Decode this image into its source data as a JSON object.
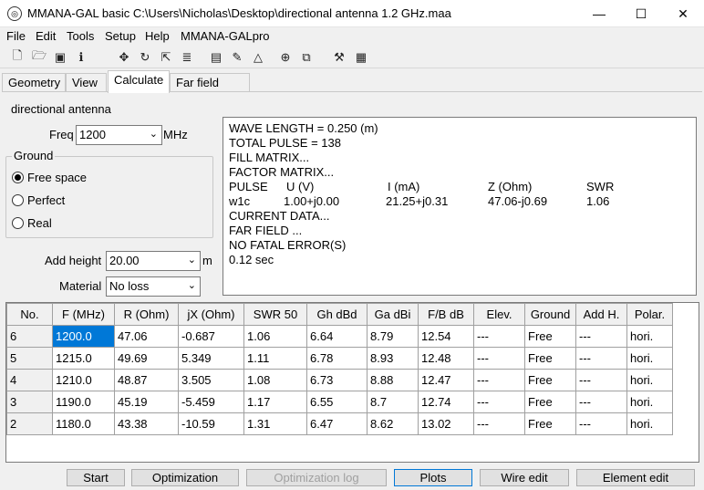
{
  "window": {
    "title": "MMANA-GAL basic C:\\Users\\Nicholas\\Desktop\\directional antenna 1.2 GHz.maa",
    "minimize": "—",
    "maximize": "☐",
    "close": "✕"
  },
  "menu": [
    "File",
    "Edit",
    "Tools",
    "Setup",
    "Help",
    "MMANA-GALpro"
  ],
  "toolbar": [
    "new-file-icon",
    "open-folder-icon",
    "save-icon",
    "info-icon",
    "move-icon",
    "rotate-icon",
    "export-icon",
    "segment-icon",
    "document-icon",
    "pen-icon",
    "triangle-icon",
    "target-icon",
    "copy-icon",
    "tools-icon",
    "calculator-icon"
  ],
  "tabs": [
    {
      "label": "Geometry",
      "active": false
    },
    {
      "label": "View",
      "active": false
    },
    {
      "label": "Calculate",
      "active": true
    },
    {
      "label": "Far field plots",
      "active": false
    }
  ],
  "calc": {
    "antenna_name": "directional antenna",
    "freq_label": "Freq",
    "freq_value": "1200",
    "freq_unit": "MHz",
    "ground_label": "Ground",
    "ground_options": [
      {
        "label": "Free space",
        "selected": true
      },
      {
        "label": "Perfect",
        "selected": false
      },
      {
        "label": "Real",
        "selected": false
      }
    ],
    "add_height_label": "Add height",
    "add_height_value": "20.00",
    "add_height_unit": "m",
    "material_label": "Material",
    "material_value": "No loss"
  },
  "output": {
    "lines_top": [
      "WAVE LENGTH = 0.250 (m)",
      "TOTAL PULSE = 138",
      "FILL MATRIX...",
      "FACTOR MATRIX..."
    ],
    "pulse_header": [
      "PULSE",
      "U (V)",
      "I (mA)",
      "Z (Ohm)",
      "SWR"
    ],
    "pulse_row": [
      "w1c",
      "1.00+j0.00",
      "21.25+j0.31",
      "47.06-j0.69",
      "1.06"
    ],
    "lines_bottom": [
      "CURRENT DATA...",
      "FAR FIELD ...",
      "NO FATAL ERROR(S)",
      "0.12 sec"
    ]
  },
  "table": {
    "headers": [
      "No.",
      "F (MHz)",
      "R (Ohm)",
      "jX (Ohm)",
      "SWR 50",
      "Gh dBd",
      "Ga dBi",
      "F/B dB",
      "Elev.",
      "Ground",
      "Add H.",
      "Polar."
    ],
    "rows": [
      [
        "6",
        "1200.0",
        "47.06",
        "-0.687",
        "1.06",
        "6.64",
        "8.79",
        "12.54",
        "---",
        "Free",
        "---",
        "hori."
      ],
      [
        "5",
        "1215.0",
        "49.69",
        "5.349",
        "1.11",
        "6.78",
        "8.93",
        "12.48",
        "---",
        "Free",
        "---",
        "hori."
      ],
      [
        "4",
        "1210.0",
        "48.87",
        "3.505",
        "1.08",
        "6.73",
        "8.88",
        "12.47",
        "---",
        "Free",
        "---",
        "hori."
      ],
      [
        "3",
        "1190.0",
        "45.19",
        "-5.459",
        "1.17",
        "6.55",
        "8.7",
        "12.74",
        "---",
        "Free",
        "---",
        "hori."
      ],
      [
        "2",
        "1180.0",
        "43.38",
        "-10.59",
        "1.31",
        "6.47",
        "8.62",
        "13.02",
        "---",
        "Free",
        "---",
        "hori."
      ]
    ],
    "selected_cell": "1200.0"
  },
  "buttons": {
    "start": "Start",
    "optimization": "Optimization",
    "optimization_log": "Optimization log",
    "plots": "Plots",
    "wire_edit": "Wire edit",
    "element_edit": "Element edit"
  }
}
